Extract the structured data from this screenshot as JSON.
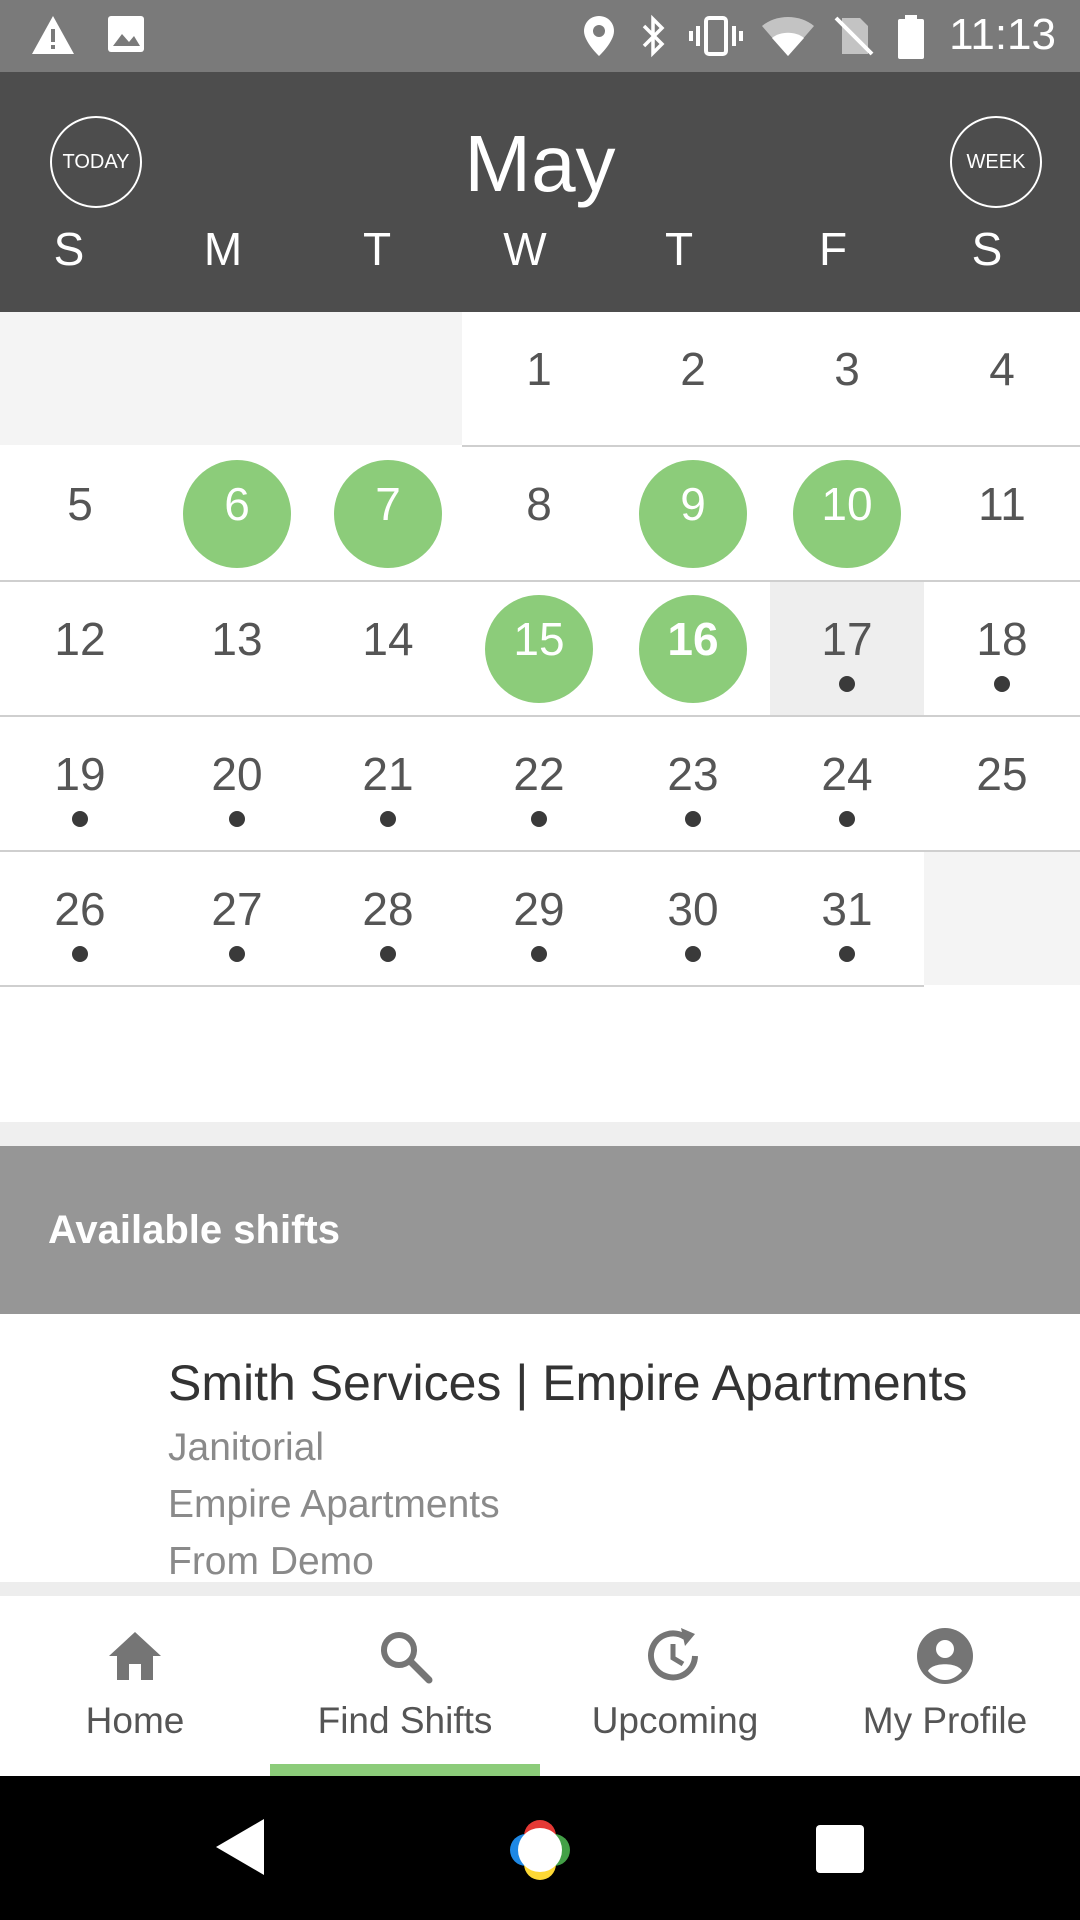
{
  "status_bar": {
    "time": "11:13",
    "icons": [
      "warning-icon",
      "image-icon",
      "location-icon",
      "bluetooth-icon",
      "vibrate-icon",
      "wifi-icon",
      "no-sim-icon",
      "battery-icon"
    ]
  },
  "calendar": {
    "today_label": "TODAY",
    "week_label": "WEEK",
    "month": "May",
    "weekdays": [
      "S",
      "M",
      "T",
      "W",
      "T",
      "F",
      "S"
    ],
    "weeks": [
      [
        null,
        null,
        null,
        "1",
        "2",
        "3",
        "4"
      ],
      [
        "5",
        "6",
        "7",
        "8",
        "9",
        "10",
        "11"
      ],
      [
        "12",
        "13",
        "14",
        "15",
        "16",
        "17",
        "18"
      ],
      [
        "19",
        "20",
        "21",
        "22",
        "23",
        "24",
        "25"
      ],
      [
        "26",
        "27",
        "28",
        "29",
        "30",
        "31",
        null
      ]
    ],
    "highlighted_days": [
      "6",
      "7",
      "9",
      "10",
      "15",
      "16"
    ],
    "current_day": "16",
    "selected_day": "17",
    "days_with_dots": [
      "17",
      "18",
      "19",
      "20",
      "21",
      "22",
      "23",
      "24",
      "26",
      "27",
      "28",
      "29",
      "30",
      "31"
    ],
    "colors": {
      "highlight": "#8ccc7a",
      "header": "#4d4d4d"
    }
  },
  "shifts": {
    "section_title": "Available shifts",
    "items": [
      {
        "title": "Smith Services | Empire Apartments",
        "category": "Janitorial",
        "location": "Empire Apartments",
        "source": "From Demo"
      }
    ]
  },
  "bottom_nav": {
    "items": [
      {
        "label": "Home",
        "icon": "home-icon"
      },
      {
        "label": "Find Shifts",
        "icon": "search-icon"
      },
      {
        "label": "Upcoming",
        "icon": "history-icon"
      },
      {
        "label": "My Profile",
        "icon": "account-icon"
      }
    ],
    "active_index": 1
  },
  "system_nav": {
    "icons": [
      "back-icon",
      "assistant-home-icon",
      "recents-icon"
    ]
  }
}
